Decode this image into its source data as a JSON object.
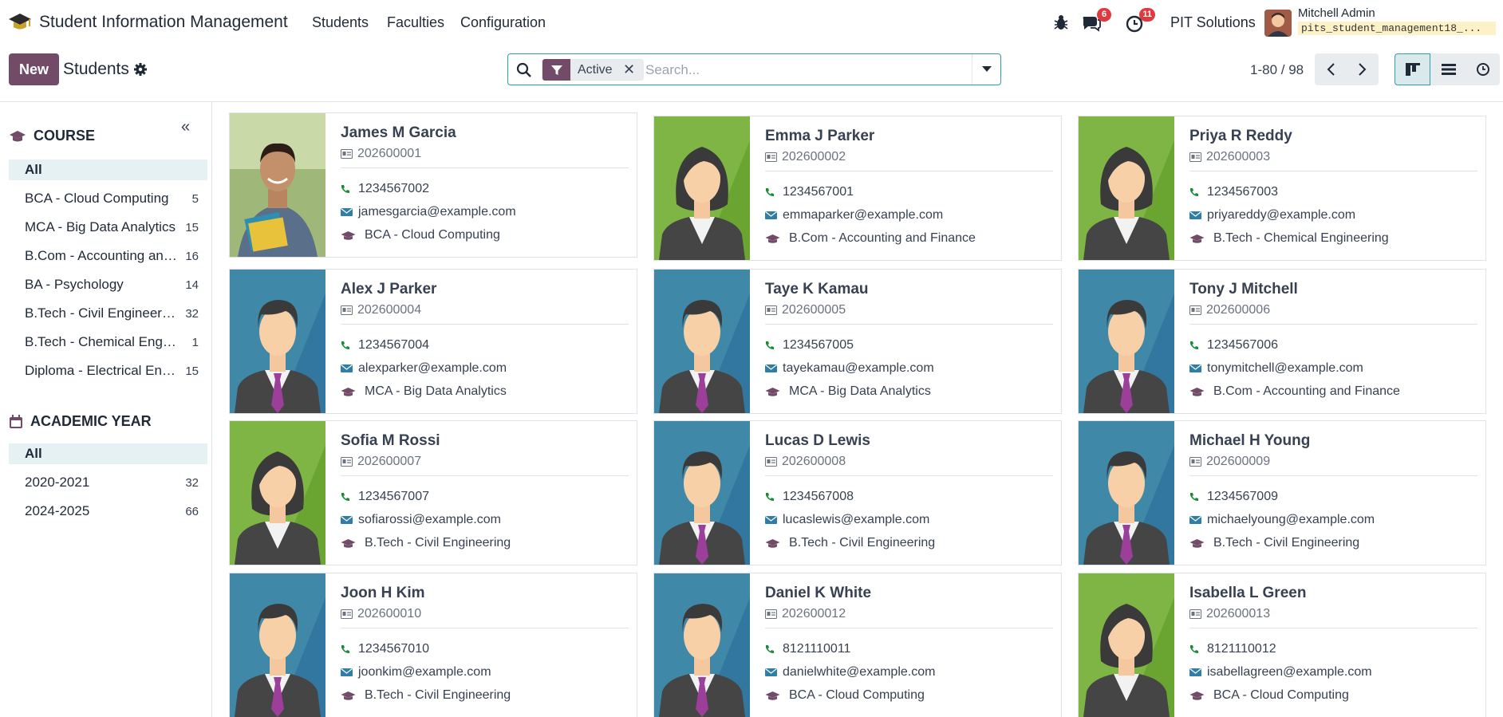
{
  "navbar": {
    "app_title": "Student Information Management",
    "menus": [
      "Students",
      "Faculties",
      "Configuration"
    ],
    "messages_badge": "6",
    "activities_badge": "11",
    "company": "PIT Solutions",
    "user_name": "Mitchell Admin",
    "database": "pits_student_management18_..."
  },
  "control": {
    "new_label": "New",
    "breadcrumb": "Students",
    "facet_label": "Active",
    "search_placeholder": "Search...",
    "pager": "1-80 / 98"
  },
  "colors": {
    "brand": "#714b67",
    "accent": "#2e9ea8",
    "badge": "#e0393e"
  },
  "sidebar": {
    "course_title": "COURSE",
    "courses": [
      {
        "label": "All",
        "count": ""
      },
      {
        "label": "BCA - Cloud Computing",
        "count": "5"
      },
      {
        "label": "MCA - Big Data Analytics",
        "count": "15"
      },
      {
        "label": "B.Com - Accounting and Finance",
        "count": "16"
      },
      {
        "label": "BA - Psychology",
        "count": "14"
      },
      {
        "label": "B.Tech - Civil Engineering",
        "count": "32"
      },
      {
        "label": "B.Tech - Chemical Engineering",
        "count": "1"
      },
      {
        "label": "Diploma - Electrical Engineering",
        "count": "15"
      }
    ],
    "year_title": "ACADEMIC YEAR",
    "years": [
      {
        "label": "All",
        "count": ""
      },
      {
        "label": "2020-2021",
        "count": "32"
      },
      {
        "label": "2024-2025",
        "count": "66"
      }
    ]
  },
  "students": [
    {
      "name": "James M Garcia",
      "id": "202600001",
      "phone": "1234567002",
      "email": "jamesgarcia@example.com",
      "course": "BCA - Cloud Computing",
      "photo": "real"
    },
    {
      "name": "Emma J Parker",
      "id": "202600002",
      "phone": "1234567001",
      "email": "emmaparker@example.com",
      "course": "B.Com - Accounting and Finance",
      "photo": "female"
    },
    {
      "name": "Priya R Reddy",
      "id": "202600003",
      "phone": "1234567003",
      "email": "priyareddy@example.com",
      "course": "B.Tech - Chemical Engineering",
      "photo": "female"
    },
    {
      "name": "Alex J Parker",
      "id": "202600004",
      "phone": "1234567004",
      "email": "alexparker@example.com",
      "course": "MCA - Big Data Analytics",
      "photo": "male"
    },
    {
      "name": "Taye K Kamau",
      "id": "202600005",
      "phone": "1234567005",
      "email": "tayekamau@example.com",
      "course": "MCA - Big Data Analytics",
      "photo": "male"
    },
    {
      "name": "Tony J Mitchell",
      "id": "202600006",
      "phone": "1234567006",
      "email": "tonymitchell@example.com",
      "course": "B.Com - Accounting and Finance",
      "photo": "male"
    },
    {
      "name": "Sofia M Rossi",
      "id": "202600007",
      "phone": "1234567007",
      "email": "sofiarossi@example.com",
      "course": "B.Tech - Civil Engineering",
      "photo": "female"
    },
    {
      "name": "Lucas D Lewis",
      "id": "202600008",
      "phone": "1234567008",
      "email": "lucaslewis@example.com",
      "course": "B.Tech - Civil Engineering",
      "photo": "male"
    },
    {
      "name": "Michael H Young",
      "id": "202600009",
      "phone": "1234567009",
      "email": "michaelyoung@example.com",
      "course": "B.Tech - Civil Engineering",
      "photo": "male"
    },
    {
      "name": "Joon H Kim",
      "id": "202600010",
      "phone": "1234567010",
      "email": "joonkim@example.com",
      "course": "B.Tech - Civil Engineering",
      "photo": "male"
    },
    {
      "name": "Daniel K White",
      "id": "202600012",
      "phone": "8121110011",
      "email": "danielwhite@example.com",
      "course": "BCA - Cloud Computing",
      "photo": "male"
    },
    {
      "name": "Isabella L Green",
      "id": "202600013",
      "phone": "8121110012",
      "email": "isabellagreen@example.com",
      "course": "BCA - Cloud Computing",
      "photo": "female"
    }
  ]
}
